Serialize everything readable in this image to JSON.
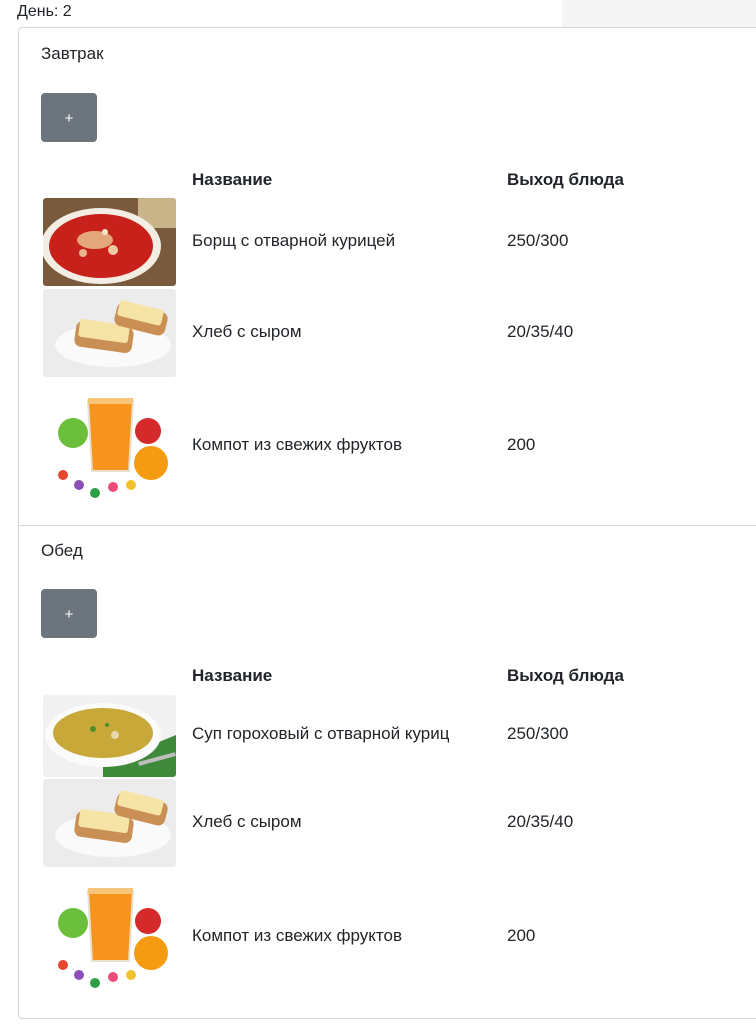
{
  "day": {
    "label": "День: 2"
  },
  "table_headers": {
    "name": "Название",
    "yield": "Выход блюда"
  },
  "add_button_label": "+",
  "meals": [
    {
      "title": "Завтрак",
      "dishes": [
        {
          "name": "Борщ с отварной курицей",
          "yield": "250/300",
          "image": "borscht-image"
        },
        {
          "name": "Хлеб с сыром",
          "yield": "20/35/40",
          "image": "bread-cheese-image"
        },
        {
          "name": "Компот из свежих фруктов",
          "yield": "200",
          "image": "fruit-compote-image"
        }
      ]
    },
    {
      "title": "Обед",
      "dishes": [
        {
          "name": "Суп гороховый с отварной курицей",
          "yield": "250/300",
          "image": "pea-soup-image"
        },
        {
          "name": "Хлеб с сыром",
          "yield": "20/35/40",
          "image": "bread-cheese-image"
        },
        {
          "name": "Компот из свежих фруктов",
          "yield": "200",
          "image": "fruit-compote-image"
        }
      ]
    }
  ],
  "colors": {
    "button": "#6c757d",
    "border": "#d5d5d5",
    "text": "#212529"
  }
}
